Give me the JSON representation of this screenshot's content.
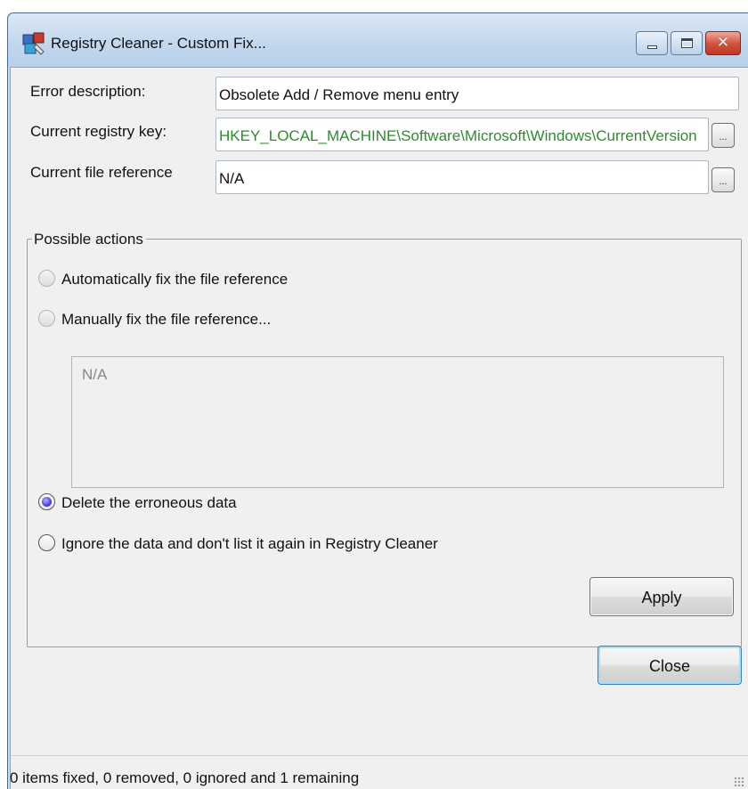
{
  "window": {
    "title": "Registry Cleaner - Custom Fix...",
    "icon": "registry-cleaner-icon",
    "controls": {
      "minimize": "minimize-icon",
      "maximize": "maximize-icon",
      "close": "✕"
    }
  },
  "fields": {
    "error_description": {
      "label": "Error description:",
      "value": "Obsolete Add / Remove menu entry"
    },
    "registry_key": {
      "label": "Current registry key:",
      "value": "HKEY_LOCAL_MACHINE\\Software\\Microsoft\\Windows\\CurrentVersion",
      "browse_label": "...",
      "value_color": "#2e8b2e"
    },
    "file_reference": {
      "label": "Current file reference",
      "value": "N/A",
      "browse_label": "..."
    }
  },
  "actions": {
    "group_title": "Possible actions",
    "options": [
      {
        "label": "Automatically fix the file reference",
        "checked": false,
        "enabled": false
      },
      {
        "label": "Manually fix the file reference...",
        "checked": false,
        "enabled": false
      },
      {
        "label": "Delete the erroneous data",
        "checked": true,
        "enabled": true
      },
      {
        "label": "Ignore the data and don't list it again in Registry Cleaner",
        "checked": false,
        "enabled": true
      }
    ],
    "manual_text": "N/A",
    "apply_label": "Apply"
  },
  "footer": {
    "close_label": "Close",
    "status": "0 items fixed, 0 removed, 0 ignored and 1 remaining"
  },
  "colors": {
    "titlebar": "#c3d8ee",
    "client": "#f0f0f0",
    "radio_checked": "#4a3fe0"
  }
}
